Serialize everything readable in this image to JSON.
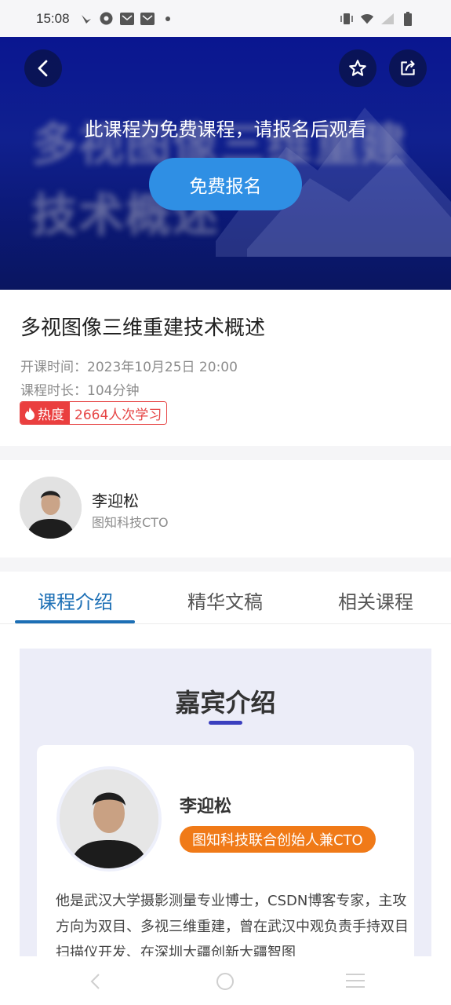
{
  "status_bar": {
    "time": "15:08",
    "left_icons": [
      "bird-icon",
      "chrome-icon",
      "mail-icon",
      "mail-icon",
      "dot-icon"
    ],
    "right_icons": [
      "vibrate-icon",
      "wifi-icon",
      "signal-icon",
      "battery-icon"
    ]
  },
  "hero": {
    "bg_line1": "多视图像三维重建",
    "bg_line2": "技术概述",
    "notice": "此课程为免费课程，请报名后观看",
    "enroll_label": "免费报名"
  },
  "course": {
    "title": "多视图像三维重建技术概述",
    "start_time": "开课时间：2023年10月25日 20:00",
    "duration": "课程时长：104分钟",
    "heat_label": "热度",
    "heat_value": "2664人次学习"
  },
  "teacher": {
    "name": "李迎松",
    "role": "图知科技CTO"
  },
  "tabs": [
    {
      "label": "课程介绍",
      "active": true
    },
    {
      "label": "精华文稿",
      "active": false
    },
    {
      "label": "相关课程",
      "active": false
    }
  ],
  "intro": {
    "heading": "嘉宾介绍",
    "guest_name": "李迎松",
    "guest_title": "图知科技联合创始人兼CTO",
    "bio": "他是武汉大学摄影测量专业博士，CSDN博客专家，主攻方向为双目、多视三维重建，曾在武汉中观负责手持双目扫描仪开发、在深圳大疆创新大疆智图"
  },
  "colors": {
    "accent_blue": "#1c6fb5",
    "enroll_button": "#2f8fe4",
    "heat_red": "#e64545",
    "guest_title_orange": "#f07a18",
    "hero_bg": "#10208f"
  }
}
